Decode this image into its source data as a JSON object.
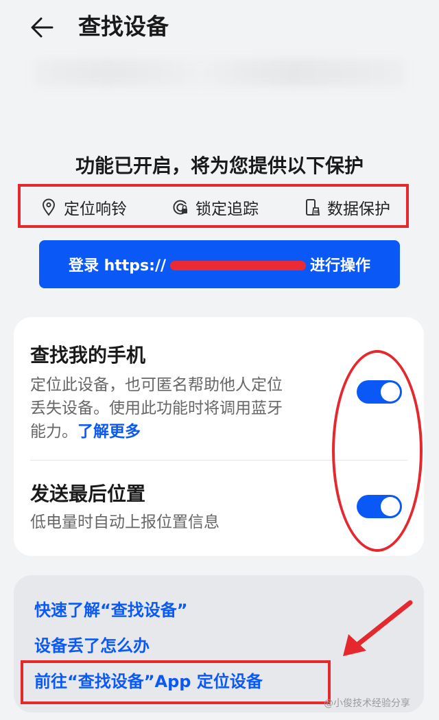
{
  "header": {
    "title": "查找设备",
    "back_icon": "arrow-left-icon"
  },
  "protection": {
    "title": "功能已开启，将为您提供以下保护",
    "features": [
      {
        "icon": "location-pin-icon",
        "label": "定位响铃"
      },
      {
        "icon": "lock-track-icon",
        "label": "锁定追踪"
      },
      {
        "icon": "phone-clean-icon",
        "label": "数据保护"
      }
    ]
  },
  "login_button": {
    "prefix": "登录 https://",
    "suffix": "进行操作"
  },
  "settings": {
    "find_phone": {
      "title": "查找我的手机",
      "desc": "定位此设备，也可匿名帮助他人定位丢失设备。使用此功能时将调用蓝牙能力。",
      "learn_more": "了解更多",
      "enabled": true
    },
    "send_last_location": {
      "title": "发送最后位置",
      "desc": "低电量时自动上报位置信息",
      "enabled": true
    }
  },
  "links": {
    "quick_learn": "快速了解“查找设备”",
    "lost_device": "设备丢了怎么办",
    "go_to_app": "前往“查找设备”App 定位设备"
  },
  "watermark": "@小俊技术经验分享",
  "colors": {
    "accent": "#0a59f7",
    "annotation_red": "#e4282e"
  }
}
